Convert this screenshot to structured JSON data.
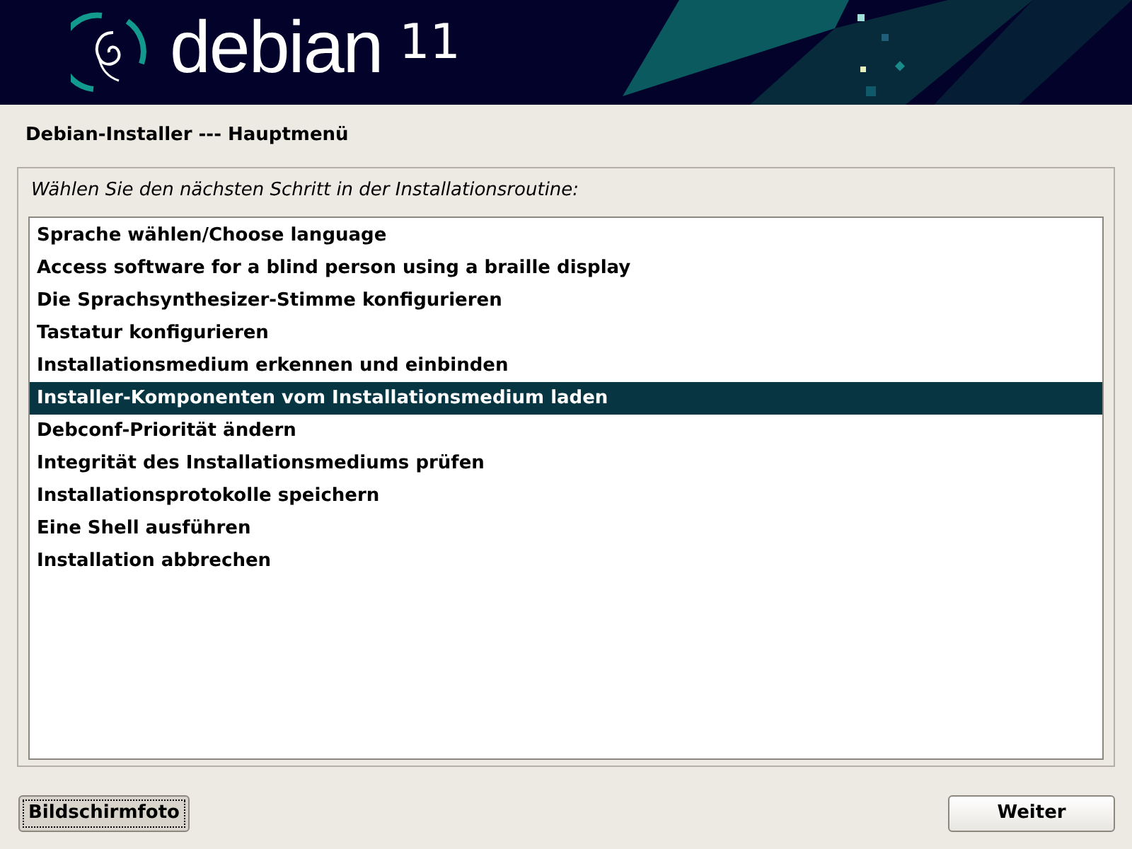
{
  "banner": {
    "logo_text": "debian",
    "version": "11"
  },
  "window": {
    "title": "Debian-Installer --- Hauptmenü"
  },
  "prompt": "Wählen Sie den nächsten Schritt in der Installationsroutine:",
  "menu_items": [
    {
      "label": "Sprache wählen/Choose language",
      "selected": false
    },
    {
      "label": "Access software for a blind person using a braille display",
      "selected": false
    },
    {
      "label": "Die Sprachsynthesizer-Stimme konfigurieren",
      "selected": false
    },
    {
      "label": "Tastatur konfigurieren",
      "selected": false
    },
    {
      "label": "Installationsmedium erkennen und einbinden",
      "selected": false
    },
    {
      "label": "Installer-Komponenten vom Installationsmedium laden",
      "selected": true
    },
    {
      "label": "Debconf-Priorität ändern",
      "selected": false
    },
    {
      "label": "Integrität des Installationsmediums prüfen",
      "selected": false
    },
    {
      "label": "Installationsprotokolle speichern",
      "selected": false
    },
    {
      "label": "Eine Shell ausführen",
      "selected": false
    },
    {
      "label": "Installation abbrechen",
      "selected": false
    }
  ],
  "buttons": [
    {
      "label": "Bildschirmfoto",
      "focused": true
    },
    {
      "label": "Weiter",
      "focused": false
    }
  ]
}
